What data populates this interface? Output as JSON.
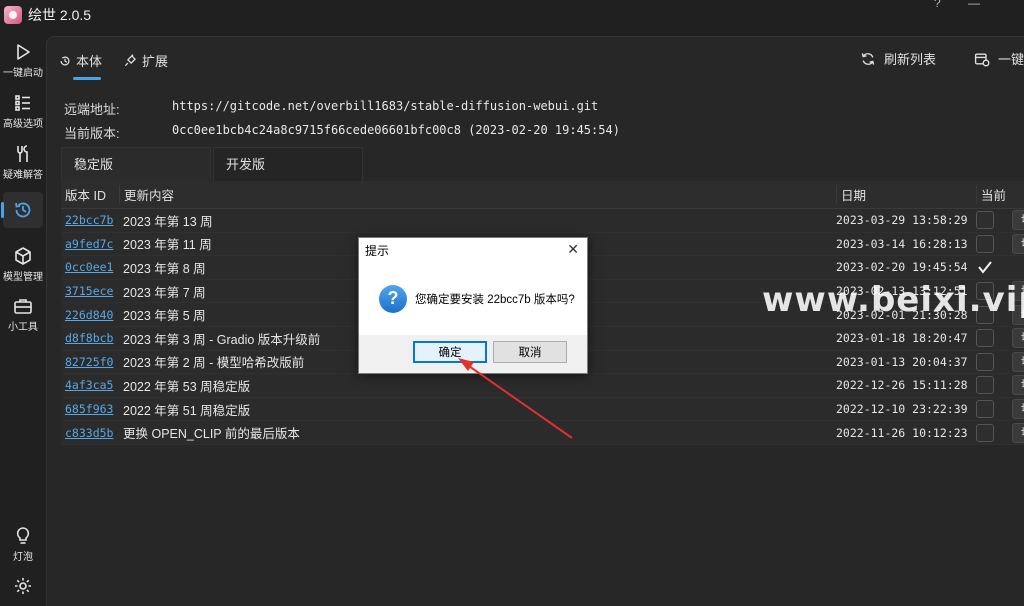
{
  "app": {
    "title": "绘世 2.0.5",
    "window_controls": [
      "?",
      "—"
    ]
  },
  "sidebar": {
    "items": [
      {
        "label": "一键启动",
        "icon": "play-icon"
      },
      {
        "label": "高级选项",
        "icon": "list-icon"
      },
      {
        "label": "疑难解答",
        "icon": "tools-icon"
      },
      {
        "label": "",
        "icon": "history-icon",
        "active": true
      },
      {
        "label": "模型管理",
        "icon": "cube-icon"
      },
      {
        "label": "小工具",
        "icon": "toolbox-icon"
      },
      {
        "label": "灯泡",
        "icon": "bulb-icon"
      },
      {
        "label": "设置",
        "icon": "gear-icon"
      }
    ]
  },
  "tabs": [
    {
      "label": "本体",
      "icon": "history-icon",
      "active": true
    },
    {
      "label": "扩展",
      "icon": "plugin-icon"
    }
  ],
  "actions": {
    "refresh": "刷新列表",
    "oneclick": "一键"
  },
  "info": {
    "remote_label": "远端地址:",
    "remote_value": "https://gitcode.net/overbill1683/stable-diffusion-webui.git",
    "version_label": "当前版本:",
    "version_value": "0cc0ee1bcb4c24a8c9715f66cede06601bfc00c8 (2023-02-20 19:45:54)"
  },
  "subtabs": [
    "稳定版",
    "开发版"
  ],
  "table": {
    "headers": {
      "id": "版本 ID",
      "desc": "更新内容",
      "date": "日期",
      "current": "当前"
    },
    "rows": [
      {
        "id": "22bcc7b",
        "desc": "2023 年第 13 周",
        "date": "2023-03-29 13:58:29",
        "current": false,
        "action": "切"
      },
      {
        "id": "a9fed7c",
        "desc": "2023 年第 11 周",
        "date": "2023-03-14 16:28:13",
        "current": false,
        "action": "切"
      },
      {
        "id": "0cc0ee1",
        "desc": "2023 年第 8 周",
        "date": "2023-02-20 19:45:54",
        "current": true,
        "action": ""
      },
      {
        "id": "3715ece",
        "desc": "2023 年第 7 周",
        "date": "2023-02-13 13:12:51",
        "current": false,
        "action": "切"
      },
      {
        "id": "226d840",
        "desc": "2023 年第 5 周",
        "date": "2023-02-01 21:30:28",
        "current": false,
        "action": "切"
      },
      {
        "id": "d8f8bcb",
        "desc": "2023 年第 3 周 - Gradio 版本升级前",
        "date": "2023-01-18 18:20:47",
        "current": false,
        "action": "切"
      },
      {
        "id": "82725f0",
        "desc": "2023 年第 2 周 - 模型哈希改版前",
        "date": "2023-01-13 20:04:37",
        "current": false,
        "action": "切"
      },
      {
        "id": "4af3ca5",
        "desc": "2022 年第 53 周稳定版",
        "date": "2022-12-26 15:11:28",
        "current": false,
        "action": "切"
      },
      {
        "id": "685f963",
        "desc": "2022 年第 51 周稳定版",
        "date": "2022-12-10 23:22:39",
        "current": false,
        "action": "切"
      },
      {
        "id": "c833d5b",
        "desc": "更换 OPEN_CLIP 前的最后版本",
        "date": "2022-11-26 10:12:23",
        "current": false,
        "action": "切"
      }
    ]
  },
  "dialog": {
    "title": "提示",
    "message": "您确定要安装 22bcc7b 版本吗?",
    "ok": "确定",
    "cancel": "取消"
  },
  "watermark": "www.beixi.vip",
  "colors": {
    "accent": "#4aa3e8",
    "link": "#58a8e6",
    "arrow": "#e03030"
  }
}
